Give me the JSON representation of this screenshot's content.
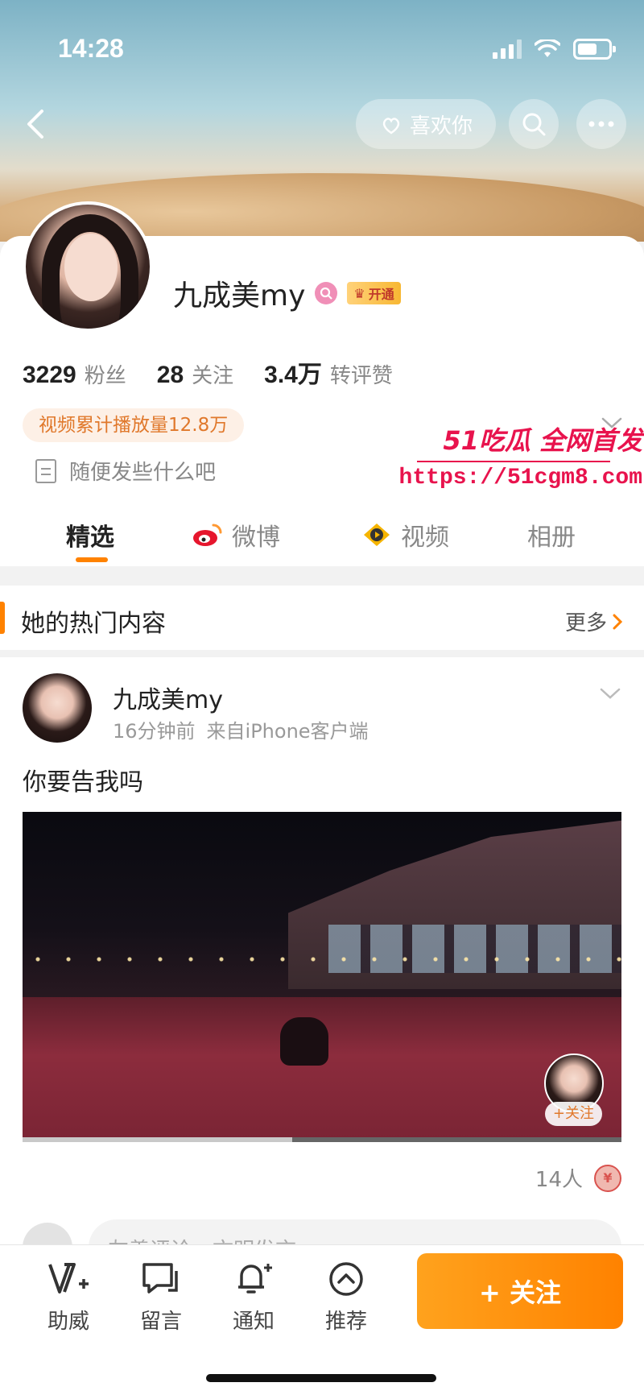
{
  "status_bar": {
    "time": "14:28",
    "battery_level": 0.65
  },
  "header": {
    "like_label": "喜欢你",
    "icons": [
      "back-icon",
      "search-icon",
      "more-icon"
    ]
  },
  "profile": {
    "name": "九成美my",
    "vip_label": "开通",
    "stats": [
      {
        "value": "3229",
        "label": "粉丝"
      },
      {
        "value": "28",
        "label": "关注"
      },
      {
        "value": "3.4万",
        "label": "转评赞"
      }
    ],
    "play_count": "视频累计播放量12.8万",
    "bio": "随便发些什么吧"
  },
  "watermark": {
    "line1": "51吃瓜 全网首发",
    "line2": "https://51cgm8.com"
  },
  "tabs": [
    {
      "label": "精选",
      "active": true
    },
    {
      "label": "微博",
      "active": false
    },
    {
      "label": "视频",
      "active": false
    },
    {
      "label": "相册",
      "active": false
    }
  ],
  "hot_section": {
    "title": "她的热门内容",
    "more_label": "更多"
  },
  "post": {
    "author": "九成美my",
    "time": "16分钟前",
    "source": "来自iPhone客户端",
    "text": "你要告我吗",
    "video_progress": 0.45,
    "follow_chip": "+关注",
    "likes": "14人",
    "comment_placeholder": "友善评论，文明发言"
  },
  "bottom_bar": {
    "items": [
      {
        "label": "助威",
        "icon": "boost-icon"
      },
      {
        "label": "留言",
        "icon": "message-icon"
      },
      {
        "label": "通知",
        "icon": "bell-icon"
      },
      {
        "label": "推荐",
        "icon": "recommend-icon"
      }
    ],
    "follow_label": "+ 关注"
  },
  "colors": {
    "accent": "#ff8200",
    "watermark": "#e8134d"
  }
}
